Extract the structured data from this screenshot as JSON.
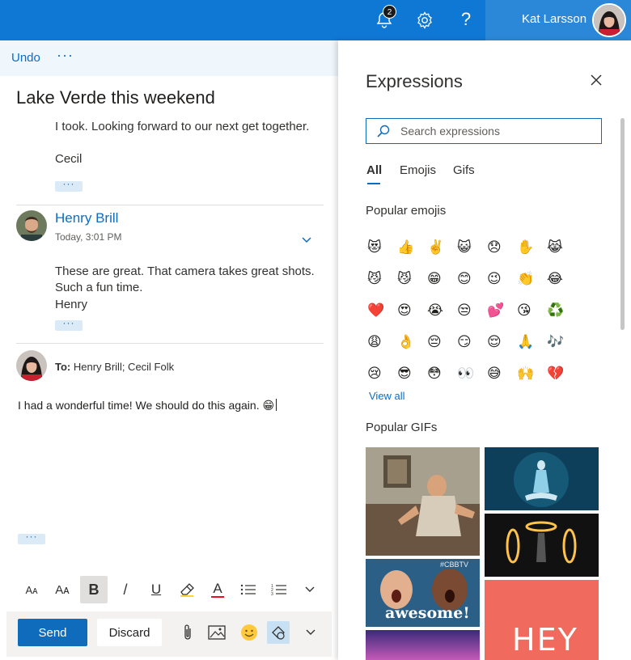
{
  "topbar": {
    "notification_count": "2",
    "help_label": "?",
    "user_name": "Kat Larsson",
    "brand_color": "#0f78d4"
  },
  "toolbar": {
    "undo_label": "Undo",
    "more_label": "···"
  },
  "thread": {
    "subject": "Lake Verde this weekend",
    "previous_message": {
      "text": "I took. Looking forward to our next get together.",
      "signature": "Cecil",
      "expand_label": "···"
    },
    "message": {
      "sender": "Henry Brill",
      "time": "Today, 3:01 PM",
      "lines": [
        "These are great. That camera takes great shots.",
        "Such a fun time.",
        "Henry"
      ],
      "expand_label": "···"
    },
    "reply": {
      "to_label": "To:",
      "recipients": "Henry Brill; Cecil Folk",
      "body": "I had a wonderful time!  We should do this again.",
      "emoji": "😁",
      "expand_label": "···"
    }
  },
  "format_bar": {
    "font_size_label": "Aᴀ",
    "font_grow_label": "Aᴀ",
    "bold_label": "B",
    "italic_label": "/",
    "underline_label": "U",
    "font_color_label": "A"
  },
  "actions": {
    "send_label": "Send",
    "discard_label": "Discard"
  },
  "expressions": {
    "title": "Expressions",
    "search_placeholder": "Search expressions",
    "tabs": [
      "All",
      "Emojis",
      "Gifs"
    ],
    "active_tab": "All",
    "popular_emojis_heading": "Popular emojis",
    "emojis": [
      "😻",
      "👍",
      "✌️",
      "😺",
      "😞",
      "✋",
      "😹",
      "😼",
      "😼",
      "😁",
      "😊",
      "😉",
      "👏",
      "😂",
      "❤️",
      "😍",
      "😭",
      "😒",
      "💕",
      "😘",
      "♻️",
      "😩",
      "👌",
      "😔",
      "😏",
      "😌",
      "🙏",
      "🎶",
      "😢",
      "😎",
      "😳",
      "👀",
      "😅",
      "🙌",
      "💔"
    ],
    "view_all_label": "View all",
    "popular_gifs_heading": "Popular GIFs",
    "gif_captions": [
      "#CBBTV",
      "awesome!",
      "HEY"
    ]
  }
}
